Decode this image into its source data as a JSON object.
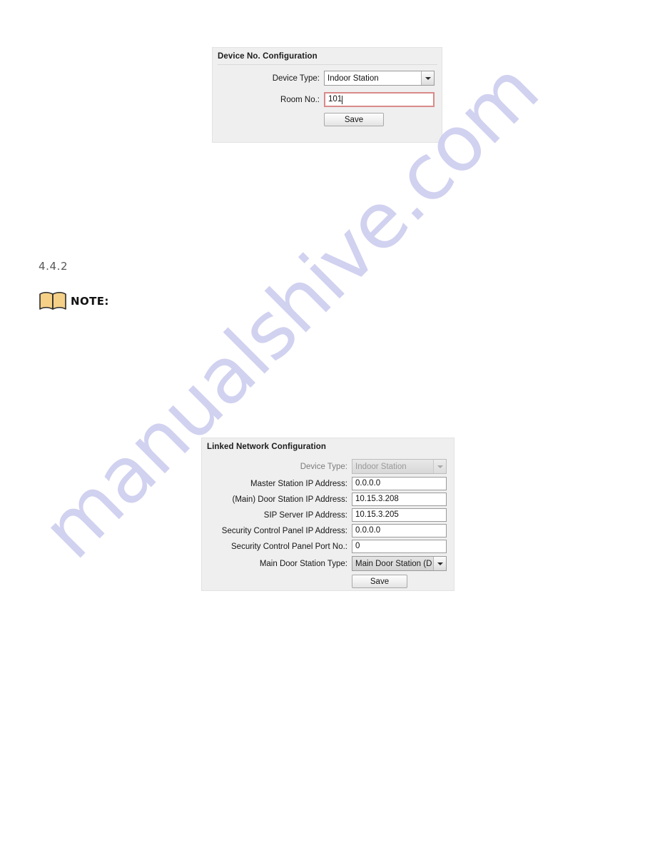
{
  "document": {
    "section_number": "4.4.2",
    "note_label": "NOTE:",
    "note_icon": "open-book-icon",
    "watermark": "manualshive.com"
  },
  "device_no_panel": {
    "title": "Device No. Configuration",
    "fields": [
      {
        "label": "Device Type:",
        "control": "select",
        "value": "Indoor Station",
        "state": "enabled"
      },
      {
        "label": "Room No.:",
        "control": "text",
        "value": "101",
        "state": "focused-error"
      }
    ],
    "save_label": "Save"
  },
  "linked_network_panel": {
    "title": "Linked Network Configuration",
    "fields": [
      {
        "label": "Device Type:",
        "control": "select",
        "value": "Indoor Station",
        "state": "disabled"
      },
      {
        "label": "Master Station IP Address:",
        "control": "text",
        "value": "0.0.0.0",
        "state": "enabled"
      },
      {
        "label": "(Main) Door Station IP Address:",
        "control": "text",
        "value": "10.15.3.208",
        "state": "enabled"
      },
      {
        "label": "SIP Server IP Address:",
        "control": "text",
        "value": "10.15.3.205",
        "state": "enabled"
      },
      {
        "label": "Security Control Panel IP Address:",
        "control": "text",
        "value": "0.0.0.0",
        "state": "enabled"
      },
      {
        "label": "Security Control Panel Port No.:",
        "control": "text",
        "value": "0",
        "state": "enabled"
      },
      {
        "label": "Main Door Station Type:",
        "control": "select",
        "value": "Main Door Station (D S...",
        "state": "enabled-gray"
      }
    ],
    "save_label": "Save"
  },
  "colors": {
    "panel_bg": "#efefef",
    "error_border": "#d98a8a",
    "watermark": "#cfcff0",
    "note_icon_fill": "#f5d087",
    "heading_text": "#585858"
  }
}
